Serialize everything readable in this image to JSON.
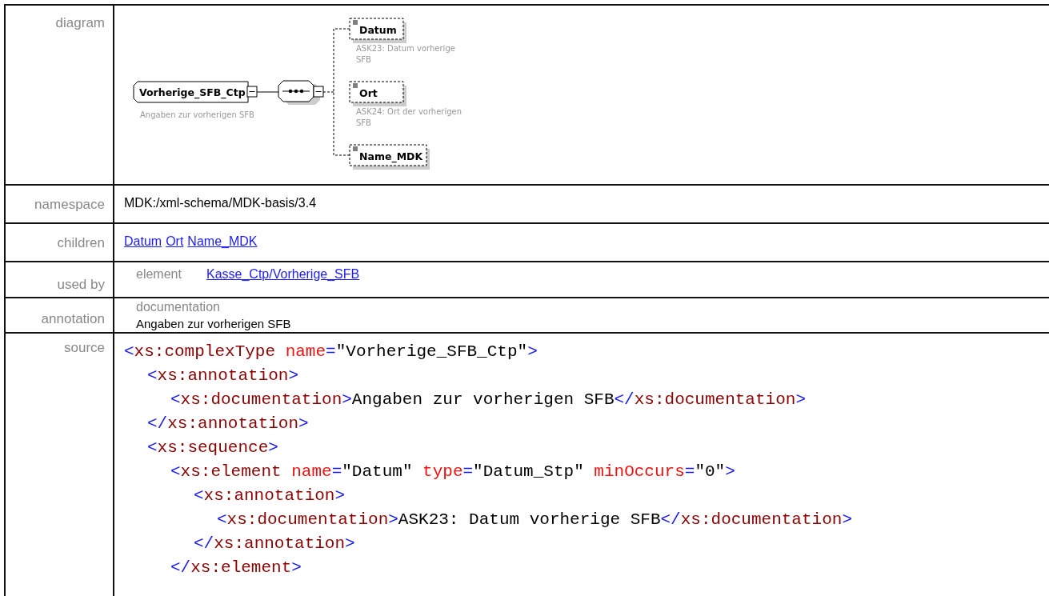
{
  "rows": [
    {
      "kind": "diagram",
      "label": "diagram",
      "diagram": {
        "root": {
          "name": "Vorherige_SFB_Ctp",
          "doc": "Angaben zur vorherigen SFB"
        },
        "compositor": {
          "kind": "sequence"
        },
        "children": [
          {
            "name": "Datum",
            "doc_lines": [
              "ASK23: Datum vorherige",
              "SFB"
            ]
          },
          {
            "name": "Ort",
            "doc_lines": [
              "ASK24: Ort der vorherigen",
              "SFB"
            ]
          },
          {
            "name": "Name_MDK"
          }
        ]
      }
    },
    {
      "kind": "text",
      "label": "namespace",
      "text": "MDK:/xml-schema/MDK-basis/3.4"
    },
    {
      "kind": "links",
      "label": "children",
      "links": [
        "Datum",
        "Ort",
        "Name_MDK"
      ]
    },
    {
      "kind": "usedby",
      "label": "used by",
      "type": "element",
      "link": "Kasse_Ctp/Vorherige_SFB"
    },
    {
      "kind": "annotation",
      "label": "annotation",
      "heading": "documentation",
      "text": "Angaben zur vorherigen SFB"
    },
    {
      "kind": "source",
      "label": "source",
      "code": [
        {
          "tokens": [
            {
              "kind": "punct",
              "text": "<"
            },
            {
              "kind": "tag",
              "text": "xs:complexType"
            },
            {
              "kind": "attr",
              "text": " name"
            },
            {
              "kind": "punct",
              "text": "="
            },
            {
              "kind": "value",
              "text": "\"Vorherige_SFB_Ctp\""
            },
            {
              "kind": "punct",
              "text": ">"
            }
          ],
          "children": [
            {
              "tokens": [
                {
                  "kind": "punct",
                  "text": "<"
                },
                {
                  "kind": "tag",
                  "text": "xs:annotation"
                },
                {
                  "kind": "punct",
                  "text": ">"
                }
              ],
              "children": [
                {
                  "tokens": [
                    {
                      "kind": "punct",
                      "text": "<"
                    },
                    {
                      "kind": "tag",
                      "text": "xs:documentation"
                    },
                    {
                      "kind": "punct",
                      "text": ">"
                    },
                    {
                      "kind": "value",
                      "text": "Angaben zur vorherigen SFB"
                    },
                    {
                      "kind": "punct",
                      "text": "</"
                    },
                    {
                      "kind": "tag",
                      "text": "xs:documentation"
                    },
                    {
                      "kind": "punct",
                      "text": ">"
                    }
                  ]
                }
              ],
              "end": [
                {
                  "kind": "punct",
                  "text": "</"
                },
                {
                  "kind": "tag",
                  "text": "xs:annotation"
                },
                {
                  "kind": "punct",
                  "text": ">"
                }
              ]
            },
            {
              "tokens": [
                {
                  "kind": "punct",
                  "text": "<"
                },
                {
                  "kind": "tag",
                  "text": "xs:sequence"
                },
                {
                  "kind": "punct",
                  "text": ">"
                }
              ],
              "children": [
                {
                  "tokens": [
                    {
                      "kind": "punct",
                      "text": "<"
                    },
                    {
                      "kind": "tag",
                      "text": "xs:element"
                    },
                    {
                      "kind": "attr",
                      "text": " name"
                    },
                    {
                      "kind": "punct",
                      "text": "="
                    },
                    {
                      "kind": "value",
                      "text": "\"Datum\""
                    },
                    {
                      "kind": "attr",
                      "text": " type"
                    },
                    {
                      "kind": "punct",
                      "text": "="
                    },
                    {
                      "kind": "value",
                      "text": "\"Datum_Stp\""
                    },
                    {
                      "kind": "attr",
                      "text": " minOccurs"
                    },
                    {
                      "kind": "punct",
                      "text": "="
                    },
                    {
                      "kind": "value",
                      "text": "\"0\""
                    },
                    {
                      "kind": "punct",
                      "text": ">"
                    }
                  ],
                  "children": [
                    {
                      "tokens": [
                        {
                          "kind": "punct",
                          "text": "<"
                        },
                        {
                          "kind": "tag",
                          "text": "xs:annotation"
                        },
                        {
                          "kind": "punct",
                          "text": ">"
                        }
                      ],
                      "children": [
                        {
                          "tokens": [
                            {
                              "kind": "punct",
                              "text": "<"
                            },
                            {
                              "kind": "tag",
                              "text": "xs:documentation"
                            },
                            {
                              "kind": "punct",
                              "text": ">"
                            },
                            {
                              "kind": "value",
                              "text": "ASK23: Datum vorherige SFB"
                            },
                            {
                              "kind": "punct",
                              "text": "</"
                            },
                            {
                              "kind": "tag",
                              "text": "xs:documentation"
                            },
                            {
                              "kind": "punct",
                              "text": ">"
                            }
                          ]
                        }
                      ],
                      "end": [
                        {
                          "kind": "punct",
                          "text": "</"
                        },
                        {
                          "kind": "tag",
                          "text": "xs:annotation"
                        },
                        {
                          "kind": "punct",
                          "text": ">"
                        }
                      ]
                    }
                  ],
                  "end": [
                    {
                      "kind": "punct",
                      "text": "</"
                    },
                    {
                      "kind": "tag",
                      "text": "xs:element"
                    },
                    {
                      "kind": "punct",
                      "text": ">"
                    }
                  ]
                }
              ]
            }
          ]
        }
      ]
    }
  ]
}
